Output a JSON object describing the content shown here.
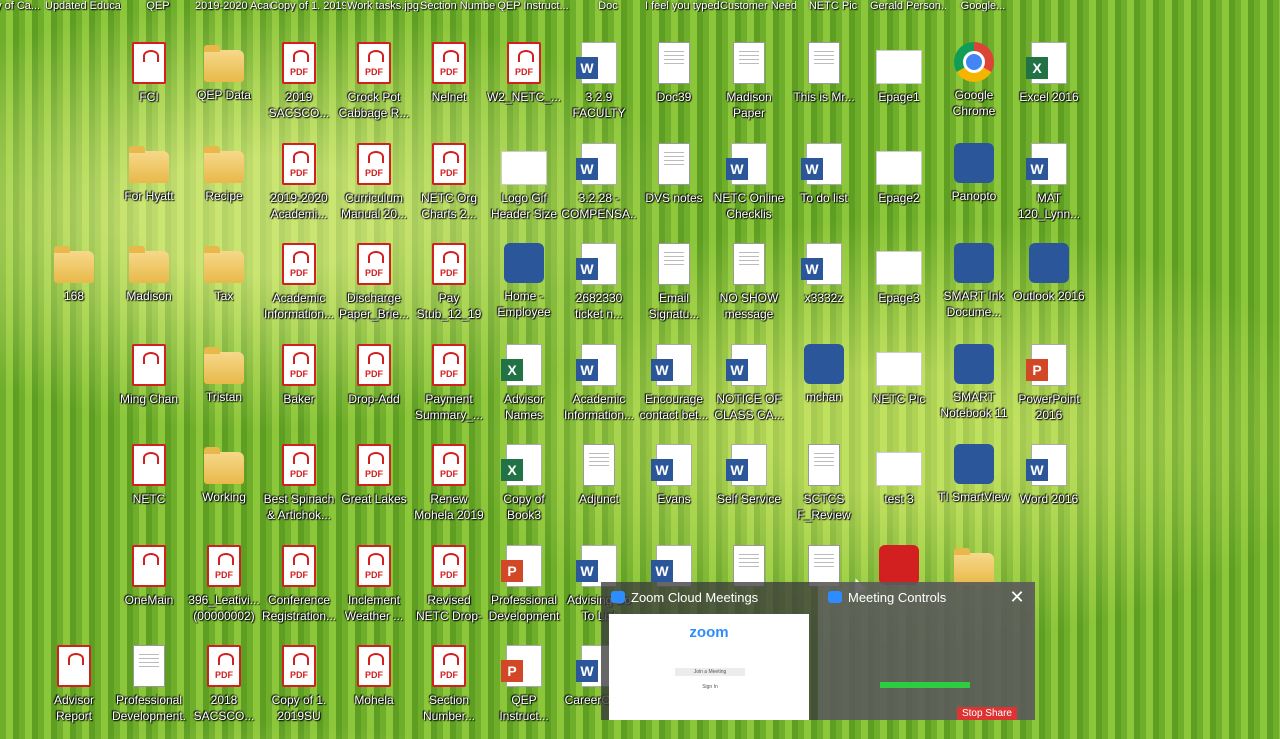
{
  "top_strip": [
    "Copy of Ca...",
    "Updated Educati...",
    "QEP",
    "2019-2020 Academi...",
    "Copy of 1. 2019SU Full...",
    "Work tasks.jpg",
    "Section Number...",
    "QEP Instruct...",
    "Doc",
    "I feel you typed insi...",
    "Customer Needs",
    "NETC Pic",
    "Gerald Person...",
    "Google..."
  ],
  "icons": [
    {
      "label": "FCI",
      "type": "pdf-doc",
      "col": 1,
      "row": 0
    },
    {
      "label": "QEP Data",
      "type": "folder",
      "col": 2,
      "row": 0
    },
    {
      "label": "2019 SACSCO...",
      "type": "pdf",
      "col": 3,
      "row": 0
    },
    {
      "label": "Crock Pot Cabbage R...",
      "type": "pdf",
      "col": 4,
      "row": 0
    },
    {
      "label": "Nelnet",
      "type": "pdf",
      "col": 5,
      "row": 0
    },
    {
      "label": "W2_NETC_...",
      "type": "pdf",
      "col": 6,
      "row": 0
    },
    {
      "label": "3.2.9 FACULTY TE...",
      "type": "word",
      "col": 7,
      "row": 0
    },
    {
      "label": "Doc39",
      "type": "doc",
      "col": 8,
      "row": 0
    },
    {
      "label": "Madison Paper",
      "type": "doc",
      "col": 9,
      "row": 0
    },
    {
      "label": "This is Mr...",
      "type": "doc",
      "col": 10,
      "row": 0
    },
    {
      "label": "Epage1",
      "type": "blank",
      "col": 11,
      "row": 0
    },
    {
      "label": "Google Chrome",
      "type": "chrome",
      "col": 12,
      "row": 0
    },
    {
      "label": "Excel 2016",
      "type": "excel",
      "col": 13,
      "row": 0
    },
    {
      "label": "For Hyatt",
      "type": "folder",
      "col": 1,
      "row": 1
    },
    {
      "label": "Recipe",
      "type": "folder",
      "col": 2,
      "row": 1
    },
    {
      "label": "2019-2020 Academi...",
      "type": "pdf",
      "col": 3,
      "row": 1
    },
    {
      "label": "Curriculum Manual 20...",
      "type": "pdf",
      "col": 4,
      "row": 1
    },
    {
      "label": "NETC Org Charts 2...",
      "type": "pdf",
      "col": 5,
      "row": 1
    },
    {
      "label": "Logo Gif Header Size",
      "type": "image",
      "col": 6,
      "row": 1
    },
    {
      "label": "3.2.28 - COMPENSA...",
      "type": "word",
      "col": 7,
      "row": 1
    },
    {
      "label": "DVS notes",
      "type": "doc",
      "col": 8,
      "row": 1
    },
    {
      "label": "NETC Online Checklis",
      "type": "word",
      "col": 9,
      "row": 1
    },
    {
      "label": "To do list",
      "type": "word",
      "col": 10,
      "row": 1
    },
    {
      "label": "Epage2",
      "type": "blank",
      "col": 11,
      "row": 1
    },
    {
      "label": "Panopto",
      "type": "app",
      "col": 12,
      "row": 1
    },
    {
      "label": "MAT 120_Lynn...",
      "type": "word",
      "col": 13,
      "row": 1
    },
    {
      "label": "168",
      "type": "folder",
      "col": 0,
      "row": 2
    },
    {
      "label": "Madison",
      "type": "folder",
      "col": 1,
      "row": 2
    },
    {
      "label": "Tax",
      "type": "folder",
      "col": 2,
      "row": 2
    },
    {
      "label": "Academic Information...",
      "type": "pdf",
      "col": 3,
      "row": 2
    },
    {
      "label": "Discharge Paper_Brie...",
      "type": "pdf",
      "col": 4,
      "row": 2
    },
    {
      "label": "Pay Stub_12_19",
      "type": "pdf",
      "col": 5,
      "row": 2
    },
    {
      "label": "Home - Employee",
      "type": "app",
      "col": 6,
      "row": 2
    },
    {
      "label": "2682330 ticket n...",
      "type": "word",
      "col": 7,
      "row": 2
    },
    {
      "label": "Email Signatu...",
      "type": "doc",
      "col": 8,
      "row": 2
    },
    {
      "label": "NO SHOW message",
      "type": "doc",
      "col": 9,
      "row": 2
    },
    {
      "label": "x3332z",
      "type": "word",
      "col": 10,
      "row": 2
    },
    {
      "label": "Epage3",
      "type": "blank",
      "col": 11,
      "row": 2
    },
    {
      "label": "SMART Ink Docume...",
      "type": "app",
      "col": 12,
      "row": 2
    },
    {
      "label": "Outlook 2016",
      "type": "app",
      "col": 13,
      "row": 2
    },
    {
      "label": "Ming Chan",
      "type": "pdf-doc",
      "col": 1,
      "row": 3
    },
    {
      "label": "Tristan",
      "type": "folder",
      "col": 2,
      "row": 3
    },
    {
      "label": "Baker",
      "type": "pdf",
      "col": 3,
      "row": 3
    },
    {
      "label": "Drop-Add",
      "type": "pdf",
      "col": 4,
      "row": 3
    },
    {
      "label": "Payment Summary_...",
      "type": "pdf",
      "col": 5,
      "row": 3
    },
    {
      "label": "Advisor Names",
      "type": "excel",
      "col": 6,
      "row": 3
    },
    {
      "label": "Academic Information...",
      "type": "word",
      "col": 7,
      "row": 3
    },
    {
      "label": "Encourage contact bet...",
      "type": "word",
      "col": 8,
      "row": 3
    },
    {
      "label": "NOTICE OF CLASS CA...",
      "type": "word",
      "col": 9,
      "row": 3
    },
    {
      "label": "mchan",
      "type": "app",
      "col": 10,
      "row": 3
    },
    {
      "label": "NETC Pic",
      "type": "blank",
      "col": 11,
      "row": 3
    },
    {
      "label": "SMART Notebook 11",
      "type": "app",
      "col": 12,
      "row": 3
    },
    {
      "label": "PowerPoint 2016",
      "type": "ppt",
      "col": 13,
      "row": 3
    },
    {
      "label": "NETC",
      "type": "pdf-doc",
      "col": 1,
      "row": 4
    },
    {
      "label": "Working",
      "type": "folder",
      "col": 2,
      "row": 4
    },
    {
      "label": "Best Spinach & Artichok...",
      "type": "pdf",
      "col": 3,
      "row": 4
    },
    {
      "label": "Great Lakes",
      "type": "pdf",
      "col": 4,
      "row": 4
    },
    {
      "label": "Renew Mohela 2019",
      "type": "pdf",
      "col": 5,
      "row": 4
    },
    {
      "label": "Copy of Book3",
      "type": "excel",
      "col": 6,
      "row": 4
    },
    {
      "label": "Adjunct",
      "type": "doc",
      "col": 7,
      "row": 4
    },
    {
      "label": "Evans",
      "type": "word",
      "col": 8,
      "row": 4
    },
    {
      "label": "Self Service",
      "type": "word",
      "col": 9,
      "row": 4
    },
    {
      "label": "SCTCS F_Review",
      "type": "doc",
      "col": 10,
      "row": 4
    },
    {
      "label": "test 3",
      "type": "blank",
      "col": 11,
      "row": 4
    },
    {
      "label": "TI SmartView",
      "type": "app",
      "col": 12,
      "row": 4
    },
    {
      "label": "Word 2016",
      "type": "word",
      "col": 13,
      "row": 4
    },
    {
      "label": "OneMain",
      "type": "pdf-doc",
      "col": 1,
      "row": 5
    },
    {
      "label": "396_Leativi... (00000002)",
      "type": "pdf",
      "col": 2,
      "row": 5
    },
    {
      "label": "Conference Registration...",
      "type": "pdf",
      "col": 3,
      "row": 5
    },
    {
      "label": "Inclement Weather ...",
      "type": "pdf",
      "col": 4,
      "row": 5
    },
    {
      "label": "Revised NETC Drop-Add...",
      "type": "pdf",
      "col": 5,
      "row": 5
    },
    {
      "label": "Professional Development",
      "type": "ppt",
      "col": 6,
      "row": 5
    },
    {
      "label": "Advising Do To List",
      "type": "word",
      "col": 7,
      "row": 5
    },
    {
      "label": "",
      "type": "word",
      "col": 8,
      "row": 5
    },
    {
      "label": "",
      "type": "doc",
      "col": 9,
      "row": 5
    },
    {
      "label": "",
      "type": "doc",
      "col": 10,
      "row": 5
    },
    {
      "label": "",
      "type": "acrobat",
      "col": 11,
      "row": 5
    },
    {
      "label": "",
      "type": "folder",
      "col": 12,
      "row": 5
    },
    {
      "label": "Advisor Report",
      "type": "pdf-doc",
      "col": 0,
      "row": 6
    },
    {
      "label": "Professional Development...",
      "type": "doc",
      "col": 1,
      "row": 6
    },
    {
      "label": "2018 SACSCO...",
      "type": "pdf",
      "col": 2,
      "row": 6
    },
    {
      "label": "Copy of 1. 2019SU Full...",
      "type": "pdf",
      "col": 3,
      "row": 6
    },
    {
      "label": "Mohela",
      "type": "pdf",
      "col": 4,
      "row": 6
    },
    {
      "label": "Section Number...",
      "type": "pdf",
      "col": 5,
      "row": 6
    },
    {
      "label": "QEP Instruct...",
      "type": "ppt",
      "col": 6,
      "row": 6
    },
    {
      "label": "CareerCon...",
      "type": "word",
      "col": 7,
      "row": 6
    }
  ],
  "popup": {
    "zoom_title": "Zoom Cloud Meetings",
    "zoom_brand": "zoom",
    "zoom_join": "Join a Meeting",
    "zoom_signin": "Sign In",
    "controls_title": "Meeting Controls",
    "stop_share": "Stop Share",
    "close_glyph": "✕"
  },
  "colors": {
    "pdf_red": "#d21f1f",
    "word_blue": "#2b579a",
    "excel_green": "#217346",
    "ppt_orange": "#d24726",
    "zoom_blue": "#2d8cff"
  }
}
